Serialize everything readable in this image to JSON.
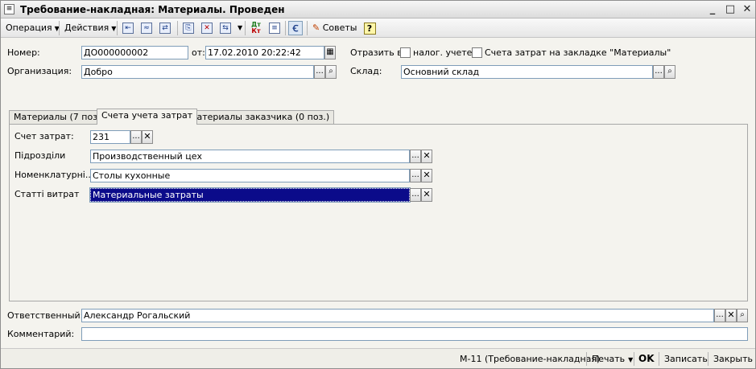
{
  "window": {
    "title": "Требование-накладная: Материалы. Проведен",
    "minimize_glyph": "_",
    "maximize_glyph": "□",
    "close_glyph": "✕"
  },
  "toolbar": {
    "operation_label": "Операция",
    "actions_label": "Действия",
    "dt_kt_top": "Дт",
    "dt_kt_bottom": "Кт",
    "tips_label": "Советы",
    "help_glyph": "?",
    "icons": [
      "go-to-first-icon",
      "list-icon",
      "refresh-icon",
      "copy-document-icon",
      "unpost-icon",
      "structure-icon",
      "dt-kt-icon",
      "journal-icon",
      "filter-icon",
      "tips-icon",
      "help-icon"
    ]
  },
  "header": {
    "number_label": "Номер:",
    "number_value": "ДО000000002",
    "date_label": "от:",
    "date_value": "17.02.2010 20:22:42",
    "reflect_label": "Отразить в:",
    "tax_accounting_label": "налог. учете",
    "tax_accounting_checked": false,
    "cost_accounts_on_tab_label": "Счета затрат на закладке \"Материалы\"",
    "cost_accounts_on_tab_checked": false,
    "organization_label": "Организация:",
    "organization_value": "Добро",
    "warehouse_label": "Склад:",
    "warehouse_value": "Основний склад"
  },
  "tabs": [
    {
      "label": "Материалы (7 поз.)",
      "active": false
    },
    {
      "label": "Счета учета затрат",
      "active": true
    },
    {
      "label": "Материалы заказчика (0 поз.)",
      "active": false
    }
  ],
  "cost_tab": {
    "account_label": "Счет затрат:",
    "account_value": "231",
    "subdivisions_label": "Підрозділи",
    "subdivisions_value": "Производственный цех",
    "nomenclature_label": "Номенклатурні...",
    "nomenclature_value": "Столы кухонные",
    "cost_items_label": "Статті витрат",
    "cost_items_value": "Материальные затраты"
  },
  "footer": {
    "responsible_label": "Ответственный:",
    "responsible_value": "Александр Рогальский",
    "comment_label": "Комментарий:",
    "comment_value": ""
  },
  "bottombar": {
    "form_label": "М-11 (Требование-накладная)",
    "print_label": "Печать",
    "ok_label": "OK",
    "save_label": "Записать",
    "close_label": "Закрыть"
  },
  "button_glyphs": {
    "select": "...",
    "clear": "✕",
    "open": "🔍",
    "calendar": "▦"
  }
}
